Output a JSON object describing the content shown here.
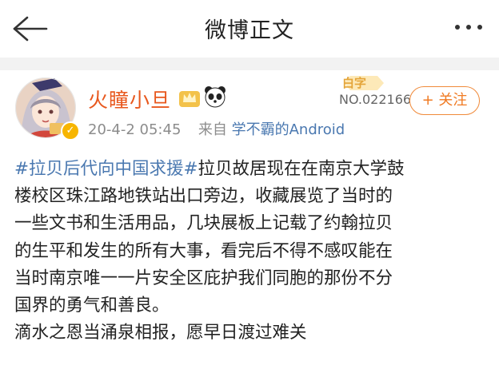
{
  "nav": {
    "title": "微博正文"
  },
  "post": {
    "username": "火瞳小旦",
    "timestamp": "20-4-2 05:45",
    "source_prefix": "来自",
    "source": "学不霸的Android",
    "badge": {
      "label": "白字",
      "number": "NO.022166"
    },
    "follow_label": "+ 关注",
    "hashtag": "#拉贝后代向中国求援#",
    "lines": [
      "拉贝故居现在在南京大学鼓",
      "楼校区珠江路地铁站出口旁边，收藏展览了当时的",
      "一些文书和生活用品，几块展板上记载了约翰拉贝",
      "的生平和发生的所有大事，看完后不得不感叹能在",
      "当时南京唯一一片安全区庇护我们同胞的那份不分",
      "国界的勇气和善良。",
      "滴水之恩当涌泉相报，愿早日渡过难关"
    ]
  },
  "icons": {
    "back": "back-arrow-icon",
    "more": "more-dots-icon",
    "verified": "verified-icon",
    "crown": "crown-icon",
    "panda": "panda-icon"
  },
  "colors": {
    "username": "#e8581e",
    "link": "#4a78b0",
    "follow": "#f07a22"
  }
}
